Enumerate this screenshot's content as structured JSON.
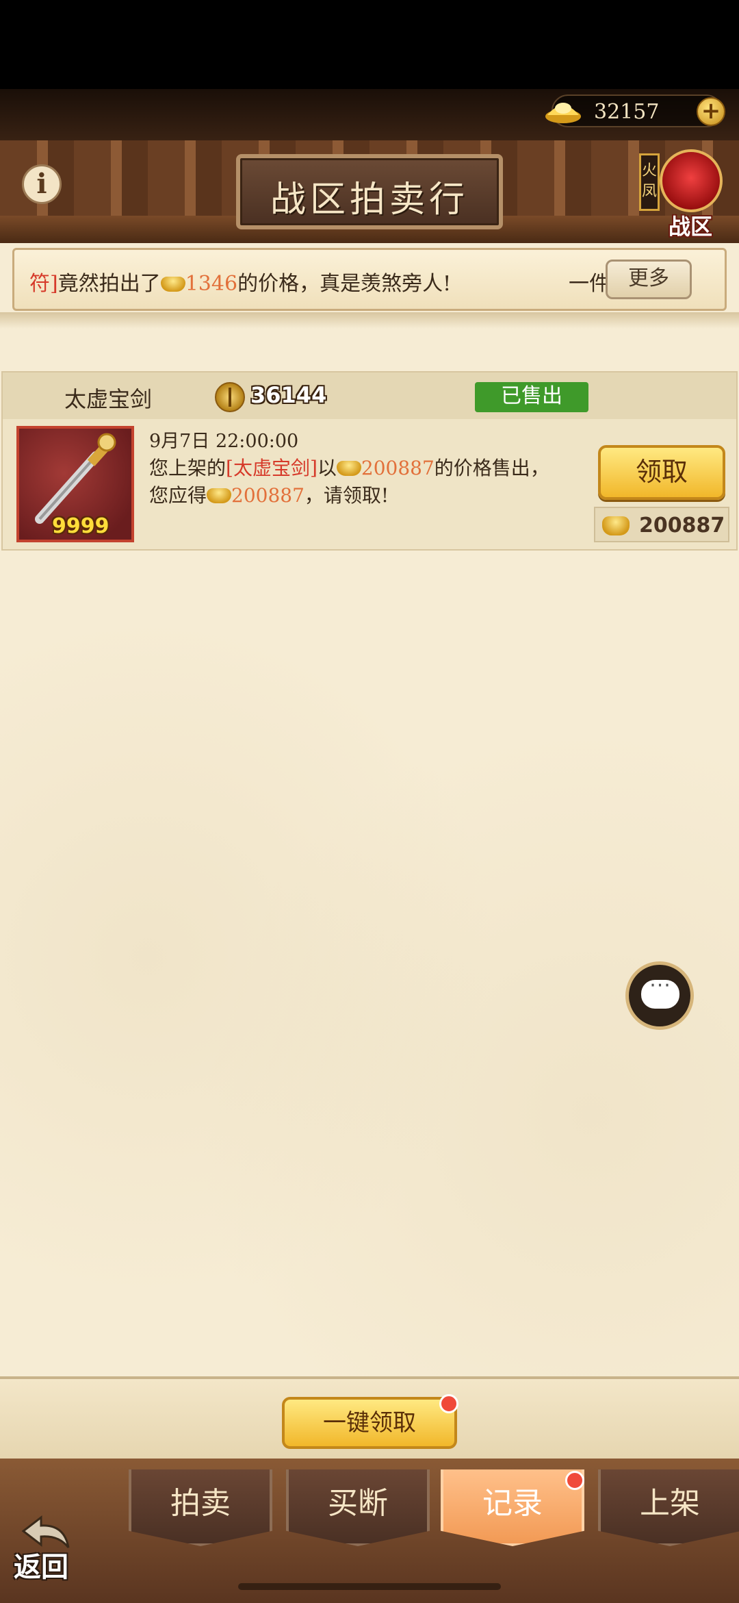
{
  "header": {
    "currency_value": "32157",
    "plus_label": "+",
    "info_label": "i",
    "title": "战区拍卖行",
    "server_tag": "火凤",
    "server_label": "战区"
  },
  "ticker": {
    "part1": "符]",
    "part2": "竟然拍出了",
    "price": "1346",
    "part3": "的价格，真是羡煞旁人!",
    "part4": "一件",
    "part5": "[",
    "more_label": "更多"
  },
  "record": {
    "item_name": "太虚宝剑",
    "price": "36144",
    "status": "已售出",
    "item_count": "9999",
    "time": "9月7日 22:00:00",
    "line1_a": "您上架的",
    "line1_item": "[太虚宝剑]",
    "line1_b": "以",
    "line1_price": "200887",
    "line1_c": "的价格售出，",
    "line2_a": "您应得",
    "line2_price": "200887",
    "line2_b": "，请领取!",
    "claim_label": "领取",
    "reward_value": "200887"
  },
  "chat": {
    "icon_text": "···"
  },
  "footer": {
    "claim_all_label": "一键领取"
  },
  "tabs": [
    {
      "label": "拍卖"
    },
    {
      "label": "买断"
    },
    {
      "label": "记录"
    },
    {
      "label": "上架"
    }
  ],
  "back_label": "返回",
  "colors": {
    "accent_gold": "#f1b72a",
    "sold_green": "#3f9a2a",
    "alert_red": "#f04a3a",
    "active_tab": "#f29a55"
  }
}
